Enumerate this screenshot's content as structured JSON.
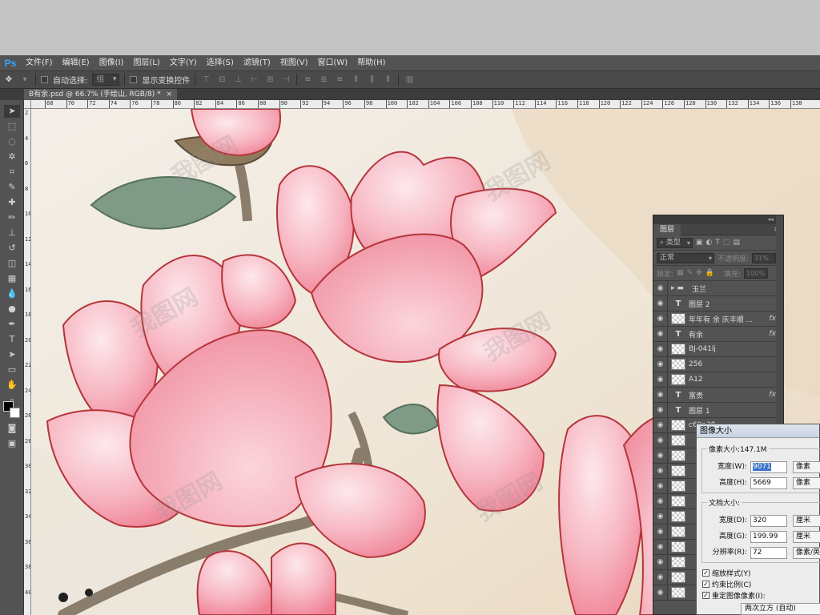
{
  "app": {
    "logo": "Ps"
  },
  "menu": [
    "文件(F)",
    "编辑(E)",
    "图像(I)",
    "图层(L)",
    "文字(Y)",
    "选择(S)",
    "滤镜(T)",
    "视图(V)",
    "窗口(W)",
    "帮助(H)"
  ],
  "options_bar": {
    "auto_select_label": "自动选择:",
    "auto_select_value": "组",
    "show_transform_label": "显示变换控件"
  },
  "document_tab": {
    "title": "B有余.psd @ 66.7% (手绘山, RGB/8) *",
    "close": "×"
  },
  "ruler_top": [
    "68",
    "70",
    "72",
    "74",
    "76",
    "78",
    "80",
    "82",
    "84",
    "86",
    "88",
    "90",
    "92",
    "94",
    "96",
    "98",
    "100",
    "102",
    "104",
    "106",
    "108",
    "110",
    "112",
    "114",
    "116",
    "118",
    "120",
    "122",
    "124",
    "126",
    "128",
    "130",
    "132",
    "134",
    "136",
    "138"
  ],
  "ruler_left": [
    "2",
    "4",
    "6",
    "8",
    "10",
    "12",
    "14",
    "16",
    "18",
    "20",
    "22",
    "24",
    "26",
    "28",
    "30",
    "32",
    "34",
    "36",
    "38",
    "40"
  ],
  "watermark": "我图网",
  "layers_panel": {
    "tab": "图层",
    "kind_filter": "类型",
    "blend_mode": "正常",
    "opacity_label": "不透明度:",
    "opacity_value": "31%",
    "lock_label": "锁定:",
    "fill_label": "填充:",
    "fill_value": "100%",
    "layers": [
      {
        "name": "玉兰",
        "type": "group",
        "fx": ""
      },
      {
        "name": "图层 2",
        "type": "text",
        "fx": ""
      },
      {
        "name": "年年有 余 庆丰顺 ...",
        "type": "image",
        "fx": "fx"
      },
      {
        "name": "有余",
        "type": "text",
        "fx": "fx"
      },
      {
        "name": "BJ-041lj",
        "type": "image",
        "fx": ""
      },
      {
        "name": "256",
        "type": "image",
        "fx": ""
      },
      {
        "name": "A12",
        "type": "image",
        "fx": ""
      },
      {
        "name": "富贵",
        "type": "text",
        "fx": "fx"
      },
      {
        "name": "图层 1",
        "type": "text",
        "fx": ""
      },
      {
        "name": "c69a38",
        "type": "image",
        "fx": ""
      },
      {
        "name": "",
        "type": "image",
        "fx": ""
      },
      {
        "name": "",
        "type": "image",
        "fx": ""
      },
      {
        "name": "",
        "type": "image",
        "fx": ""
      },
      {
        "name": "",
        "type": "image",
        "fx": ""
      },
      {
        "name": "",
        "type": "image",
        "fx": ""
      },
      {
        "name": "",
        "type": "image",
        "fx": ""
      },
      {
        "name": "",
        "type": "image",
        "fx": ""
      },
      {
        "name": "",
        "type": "image",
        "fx": ""
      },
      {
        "name": "",
        "type": "image",
        "fx": ""
      },
      {
        "name": "",
        "type": "image",
        "fx": ""
      },
      {
        "name": "",
        "type": "image",
        "fx": ""
      }
    ]
  },
  "image_size_dialog": {
    "title": "图像大小",
    "pixel_dimensions": "像素大小:147.1M",
    "width_label": "宽度(W):",
    "width_value": "9071",
    "width_unit": "像素",
    "height_label": "高度(H):",
    "height_value": "5669",
    "height_unit": "像素",
    "doc_size_label": "文档大小:",
    "doc_width_label": "宽度(D):",
    "doc_width_value": "320",
    "doc_width_unit": "厘米",
    "doc_height_label": "高度(G):",
    "doc_height_value": "199.99",
    "doc_height_unit": "厘米",
    "resolution_label": "分辨率(R):",
    "resolution_value": "72",
    "resolution_unit": "像素/英寸",
    "scale_styles": "缩放样式(Y)",
    "constrain": "约束比例(C)",
    "resample": "重定图像像素(I):",
    "resample_method": "两次立方 (自动)"
  }
}
